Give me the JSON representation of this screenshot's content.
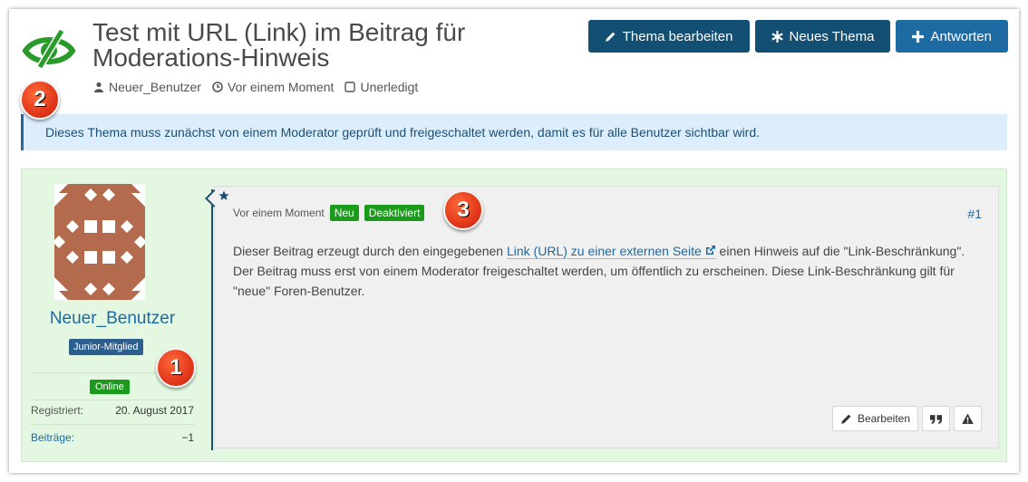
{
  "colors": {
    "accent": "#134f73",
    "primary": "#1e6aa3",
    "success": "#1c9a1c",
    "notice_bg": "#dceefc",
    "post_bg": "#e4f8e1"
  },
  "thread": {
    "title": "Test mit URL (Link) im Beitrag für Moderations-Hinweis",
    "author": "Neuer_Benutzer",
    "time": "Vor einem Moment",
    "status": "Unerledigt"
  },
  "buttons": {
    "edit_thread": "Thema bearbeiten",
    "new_thread": "Neues Thema",
    "reply": "Antworten"
  },
  "notice": "Dieses Thema muss zunächst von einem Moderator geprüft und freigeschaltet werden, damit es für alle Benutzer sichtbar wird.",
  "markers": [
    "1",
    "2",
    "3"
  ],
  "user": {
    "name": "Neuer_Benutzer",
    "rank": "Junior-Mitglied",
    "online": "Online",
    "registered_label": "Registriert:",
    "registered_value": "20. August 2017",
    "posts_label": "Beiträge:",
    "posts_value": "−1"
  },
  "post": {
    "time": "Vor einem Moment",
    "label_new": "Neu",
    "label_disabled": "Deaktiviert",
    "number": "#1",
    "text_1": "Dieser Beitrag erzeugt durch den eingegebenen ",
    "link_text": "Link (URL) zu einer externen Seite",
    "text_2": " einen Hinweis auf die \"Link-Beschränkung\". Der Beitrag muss erst von einem Moderator freigeschaltet werden, um öffentlich zu erscheinen. Diese Link-Beschränkung gilt für \"neue\" Foren-Benutzer.",
    "edit_label": "Bearbeiten"
  },
  "icons": [
    "eye-slash-logo-icon",
    "user-icon",
    "clock-icon",
    "square-icon",
    "pencil-icon",
    "asterisk-icon",
    "plus-icon",
    "star-icon",
    "external-link-icon",
    "quote-icon",
    "warning-icon"
  ]
}
